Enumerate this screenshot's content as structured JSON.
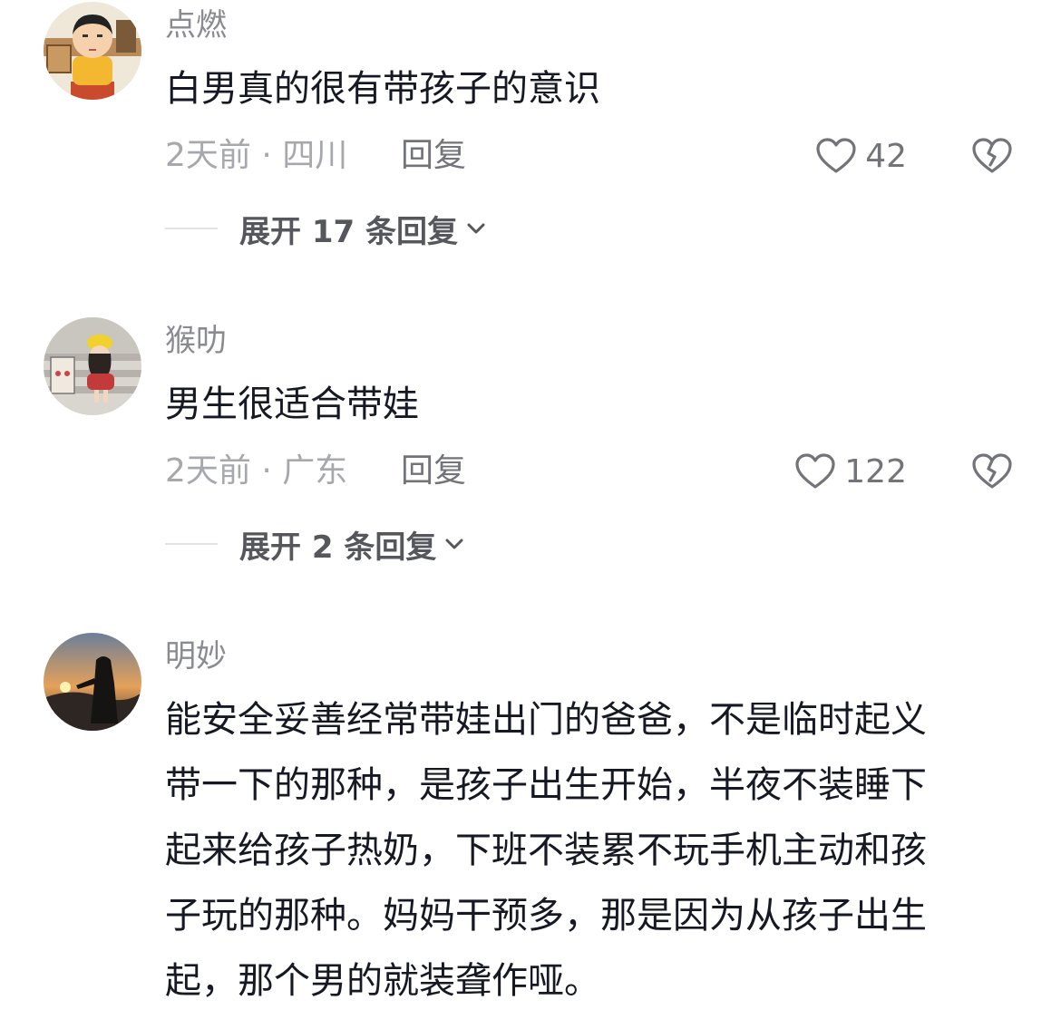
{
  "comments": [
    {
      "user": "点燃",
      "text": "白男真的很有带孩子的意识",
      "meta": "2天前 · 四川",
      "reply_label": "回复",
      "likes": "42",
      "expand": "展开 17 条回复"
    },
    {
      "user": "猴叻",
      "text": "男生很适合带娃",
      "meta": "2天前 · 广东",
      "reply_label": "回复",
      "likes": "122",
      "expand": "展开 2 条回复"
    },
    {
      "user": "明妙",
      "text_lines": [
        "能安全妥善经常带娃出门的爸爸，不是临时起义",
        "带一下的那种，是孩子出生开始，半夜不装睡下",
        "起来给孩子热奶，下班不装累不玩手机主动和孩",
        "子玩的那种。妈妈干预多，那是因为从孩子出生",
        "起，那个男的就装聋作哑。"
      ]
    }
  ],
  "icons": {
    "like": "heart-outline-icon",
    "dislike": "broken-heart-icon",
    "expand": "chevron-down-icon"
  },
  "colors": {
    "username": "#8a8b91",
    "meta": "#a7a8ad",
    "body_text": "#161823"
  }
}
